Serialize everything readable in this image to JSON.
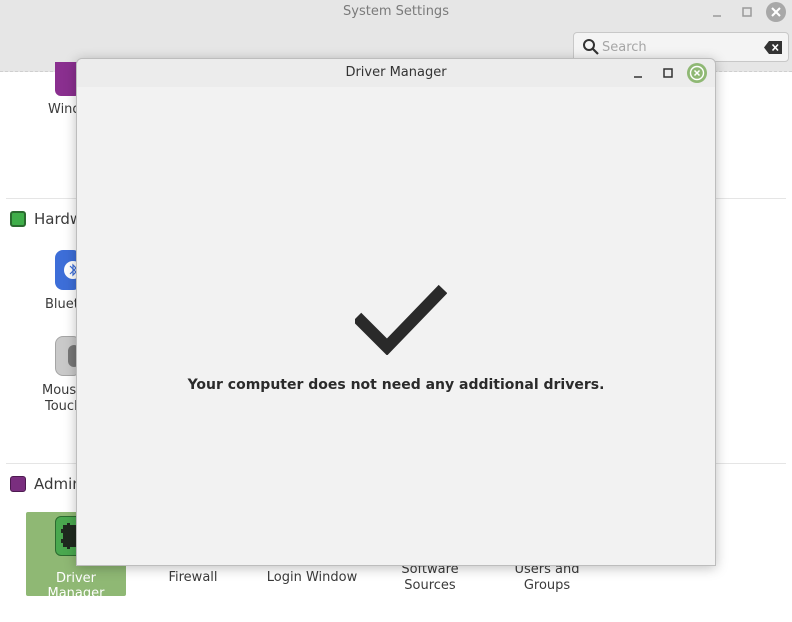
{
  "settings_window": {
    "title": "System Settings",
    "search": {
      "placeholder": "Search"
    },
    "sections": [
      {
        "name": "Hardware",
        "label": "Hardw"
      },
      {
        "name": "Administration",
        "label": "Admin"
      }
    ],
    "partial_items": {
      "windows": "Wind",
      "bluetooth": "Bluet",
      "mouse_line1": "Mous",
      "mouse_line2": "Touch"
    },
    "admin_items": {
      "driver_manager": "Driver Manager",
      "firewall": "Firewall",
      "login_window": "Login Window",
      "software_sources_line1": "Software",
      "software_sources_line2": "Sources",
      "users_groups_line1": "Users and",
      "users_groups_line2": "Groups"
    }
  },
  "driver_manager": {
    "title": "Driver Manager",
    "message": "Your computer does not need any additional drivers.",
    "status_icon": "checkmark-icon"
  },
  "colors": {
    "accent_green": "#8fb874",
    "hardware_icon": "#3fae49",
    "admin_icon": "#7a2e7f"
  }
}
